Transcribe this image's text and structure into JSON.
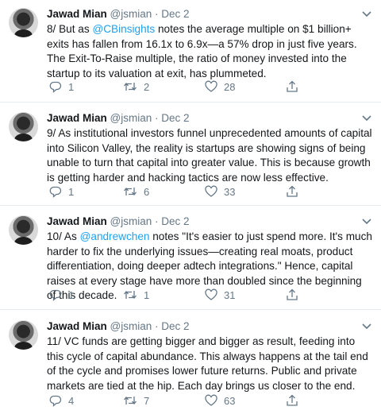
{
  "tweets": [
    {
      "name": "Jawad Mian",
      "handle": "@jsmian",
      "dot": "·",
      "date": "Dec 2",
      "text_before": "8/ But as ",
      "mention": "@CBinsights",
      "text_after": " notes the average multiple on $1 billion+ exits has fallen from 16.1x to 6.9x—a 57% drop in just five years. The Exit-To-Raise multiple, the ratio of money invested into the startup to its valuation at exit, has plummeted.",
      "replies": "1",
      "retweets": "2",
      "likes": "28"
    },
    {
      "name": "Jawad Mian",
      "handle": "@jsmian",
      "dot": "·",
      "date": "Dec 2",
      "text_before": "9/ As institutional investors funnel unprecedented amounts of capital into Silicon Valley, the reality is startups are showing signs of being unable to turn that capital into greater value. This is because growth is getting harder and hacking tactics are now less effective.",
      "mention": "",
      "text_after": "",
      "replies": "1",
      "retweets": "6",
      "likes": "33"
    },
    {
      "name": "Jawad Mian",
      "handle": "@jsmian",
      "dot": "·",
      "date": "Dec 2",
      "text_before": "10/ As ",
      "mention": "@andrewchen",
      "text_after": " notes \"It's easier to just spend more. It's much harder to fix the underlying issues—creating real moats, product differentiation, doing deeper adtech integrations.\" Hence, capital raises at every stage have more than doubled since the beginning of this decade.",
      "replies": "1",
      "retweets": "1",
      "likes": "31"
    },
    {
      "name": "Jawad Mian",
      "handle": "@jsmian",
      "dot": "·",
      "date": "Dec 2",
      "text_before": "11/ VC funds are getting bigger and bigger as result, feeding into this cycle of capital abundance. This always happens at the tail end of the cycle and promises lower future returns. Public and private markets are tied at the hip. Each day brings us closer to the end.",
      "mention": "",
      "text_after": "",
      "replies": "4",
      "retweets": "7",
      "likes": "63"
    }
  ],
  "icons": {
    "avatar": "avatar",
    "menu": "chevron-down-icon",
    "reply": "reply-icon",
    "retweet": "retweet-icon",
    "like": "heart-icon",
    "share": "share-icon"
  },
  "colors": {
    "text": "#14171a",
    "secondary": "#657786",
    "mention": "#1da1f2",
    "divider": "#e6ecf0"
  }
}
